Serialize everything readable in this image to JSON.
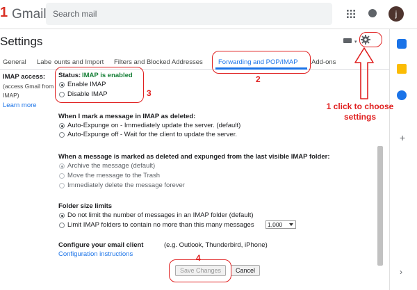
{
  "header": {
    "step_number": "1",
    "logo_text": "Gmail",
    "search_placeholder": "Search mail",
    "avatar_letter": "j"
  },
  "settings_title": "Settings",
  "tabs": [
    {
      "label": "General"
    },
    {
      "label": "Labe"
    },
    {
      "label": "ounts and Import"
    },
    {
      "label": "Filters and Blocked Addresses"
    },
    {
      "label": "Forwarding and POP/IMAP"
    },
    {
      "label": "Add-ons"
    }
  ],
  "imap": {
    "heading": "IMAP access:",
    "desc_1": "(access Gmail from",
    "desc_2": "IMAP)",
    "learn_more": "Learn more",
    "status_prefix": "Status:",
    "status_value": "IMAP is enabled",
    "enable": "Enable IMAP",
    "disable": "Disable IMAP",
    "enabled_selected": true
  },
  "deleted": {
    "heading": "When I mark a message in IMAP as deleted:",
    "opt1": "Auto-Expunge on - Immediately update the server. (default)",
    "opt2": "Auto-Expunge off - Wait for the client to update the server."
  },
  "expunged": {
    "heading": "When a message is marked as deleted and expunged from the last visible IMAP folder:",
    "opt1": "Archive the message (default)",
    "opt2": "Move the message to the Trash",
    "opt3": "Immediately delete the message forever"
  },
  "folder": {
    "heading": "Folder size limits",
    "opt1": "Do not limit the number of messages in an IMAP folder (default)",
    "opt2": "Limit IMAP folders to contain no more than this many messages",
    "select_value": "1,000"
  },
  "client": {
    "heading": "Configure your email client",
    "examples": "(e.g. Outlook, Thunderbird, iPhone)",
    "instructions": "Configuration instructions"
  },
  "buttons": {
    "save": "Save Changes",
    "cancel": "Cancel"
  },
  "annotations": {
    "step2": "2",
    "step3": "3",
    "step4": "4",
    "click_line1": "1 click to choose",
    "click_line2": "settings"
  },
  "colors": {
    "accent": "#1a73e8",
    "status_green": "#188038",
    "annotation_red": "#e02020"
  }
}
